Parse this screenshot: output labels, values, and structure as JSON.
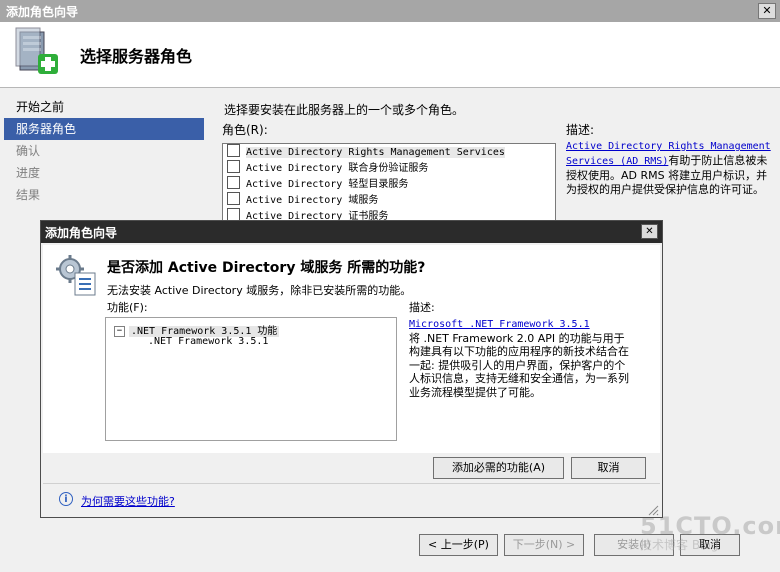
{
  "wizard": {
    "window_title": "添加角色向导",
    "close_glyph": "✕",
    "header_title": "选择服务器角色",
    "nav": [
      {
        "label": "开始之前",
        "state": "normal"
      },
      {
        "label": "服务器角色",
        "state": "selected"
      },
      {
        "label": "确认",
        "state": "disabled"
      },
      {
        "label": "进度",
        "state": "disabled"
      },
      {
        "label": "结果",
        "state": "disabled"
      }
    ],
    "instruction": "选择要安装在此服务器上的一个或多个角色。",
    "roles_label": "角色(R):",
    "roles": [
      {
        "label": "Active Directory Rights Management Services",
        "checked": false
      },
      {
        "label": "Active Directory 联合身份验证服务",
        "checked": false
      },
      {
        "label": "Active Directory 轻型目录服务",
        "checked": false
      },
      {
        "label": "Active Directory 域服务",
        "checked": false
      },
      {
        "label": "Active Directory 证书服务",
        "checked": false
      }
    ],
    "description_label": "描述:",
    "description_link": "Active Directory Rights Management Services (AD RMS)",
    "description_text": "有助于防止信息被未授权使用。AD RMS 将建立用户标识，并为授权的用户提供受保护信息的许可证。",
    "buttons": {
      "back": "< 上一步(P)",
      "next": "下一步(N) >",
      "install": "安装(I)",
      "cancel": "取消"
    },
    "watermark": "51CTO.com",
    "watermark_sub": "技术博客 Blog"
  },
  "dialog": {
    "title": "添加角色向导",
    "close_glyph": "✕",
    "heading": "是否添加 Active Directory 域服务 所需的功能?",
    "message": "无法安装 Active Directory 域服务，除非已安装所需的功能。",
    "features_label": "功能(F):",
    "features_tree": [
      {
        "label": ".NET Framework 3.5.1 功能",
        "level": 0,
        "toggle": "−"
      },
      {
        "label": ".NET Framework 3.5.1",
        "level": 1
      }
    ],
    "description_label": "描述:",
    "description_link": "Microsoft .NET Framework 3.5.1",
    "description_text": "将 .NET Framework 2.0 API 的功能与用于构建具有以下功能的应用程序的新技术结合在一起: 提供吸引人的用户界面，保护客户的个人标识信息，支持无缝和安全通信，为一系列业务流程模型提供了可能。",
    "add_button": "添加必需的功能(A)",
    "cancel_button": "取消",
    "help_icon_glyph": "i",
    "help_link": "为何需要这些功能?"
  }
}
